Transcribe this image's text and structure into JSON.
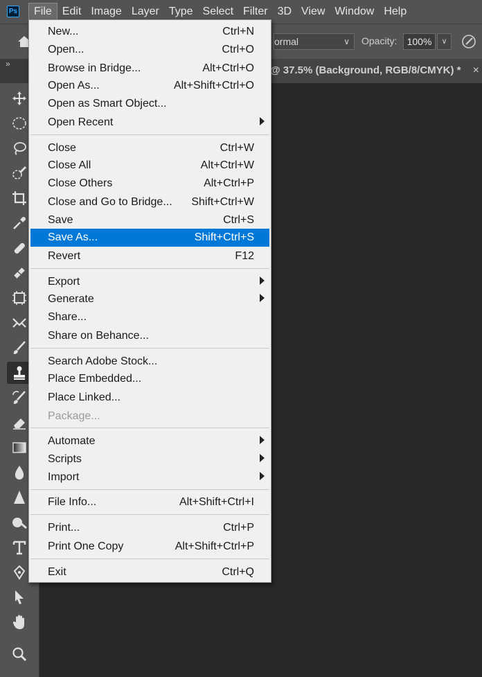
{
  "app": {
    "logo": "Ps"
  },
  "menubar": {
    "items": [
      "File",
      "Edit",
      "Image",
      "Layer",
      "Type",
      "Select",
      "Filter",
      "3D",
      "View",
      "Window",
      "Help"
    ]
  },
  "options": {
    "mode_value": "ormal",
    "opacity_label": "Opacity:",
    "opacity_value": "100%"
  },
  "tabs": {
    "document_tab": "@ 37.5% (Background, RGB/8/CMYK) *",
    "close": "×"
  },
  "file_menu": {
    "items": [
      {
        "label": "New...",
        "shortcut": "Ctrl+N"
      },
      {
        "label": "Open...",
        "shortcut": "Ctrl+O"
      },
      {
        "label": "Browse in Bridge...",
        "shortcut": "Alt+Ctrl+O"
      },
      {
        "label": "Open As...",
        "shortcut": "Alt+Shift+Ctrl+O"
      },
      {
        "label": "Open as Smart Object...",
        "shortcut": ""
      },
      {
        "label": "Open Recent",
        "shortcut": ""
      },
      {
        "label": "Close",
        "shortcut": "Ctrl+W"
      },
      {
        "label": "Close All",
        "shortcut": "Alt+Ctrl+W"
      },
      {
        "label": "Close Others",
        "shortcut": "Alt+Ctrl+P"
      },
      {
        "label": "Close and Go to Bridge...",
        "shortcut": "Shift+Ctrl+W"
      },
      {
        "label": "Save",
        "shortcut": "Ctrl+S"
      },
      {
        "label": "Save As...",
        "shortcut": "Shift+Ctrl+S"
      },
      {
        "label": "Revert",
        "shortcut": "F12"
      },
      {
        "label": "Export",
        "shortcut": ""
      },
      {
        "label": "Generate",
        "shortcut": ""
      },
      {
        "label": "Share...",
        "shortcut": ""
      },
      {
        "label": "Share on Behance...",
        "shortcut": ""
      },
      {
        "label": "Search Adobe Stock...",
        "shortcut": ""
      },
      {
        "label": "Place Embedded...",
        "shortcut": ""
      },
      {
        "label": "Place Linked...",
        "shortcut": ""
      },
      {
        "label": "Package...",
        "shortcut": ""
      },
      {
        "label": "Automate",
        "shortcut": ""
      },
      {
        "label": "Scripts",
        "shortcut": ""
      },
      {
        "label": "Import",
        "shortcut": ""
      },
      {
        "label": "File Info...",
        "shortcut": "Alt+Shift+Ctrl+I"
      },
      {
        "label": "Print...",
        "shortcut": "Ctrl+P"
      },
      {
        "label": "Print One Copy",
        "shortcut": "Alt+Shift+Ctrl+P"
      },
      {
        "label": "Exit",
        "shortcut": "Ctrl+Q"
      }
    ]
  },
  "colors": {
    "highlight": "#0078d7",
    "menu_bg": "#f0f0f0",
    "ui_bg": "#535353",
    "canvas_bg": "#282828"
  }
}
